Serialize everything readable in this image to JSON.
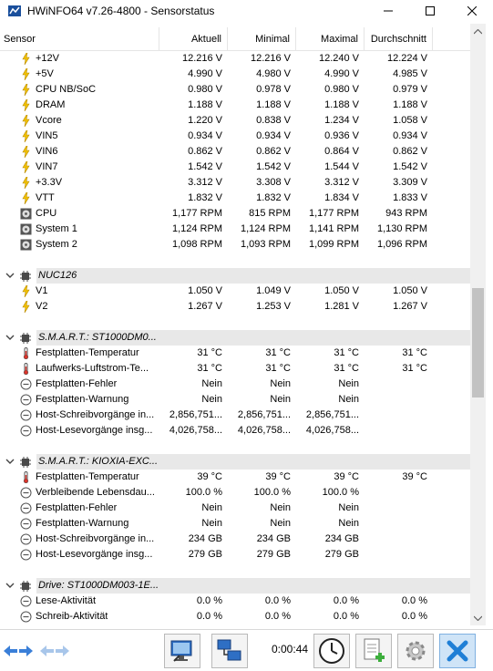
{
  "window": {
    "title": "HWiNFO64 v7.26-4800 - Sensorstatus",
    "minimize": "─",
    "maximize": "☐",
    "close": "✕"
  },
  "columns": {
    "sensor": "Sensor",
    "current": "Aktuell",
    "min": "Minimal",
    "max": "Maximal",
    "avg": "Durchschnitt"
  },
  "rows": [
    {
      "kind": "item",
      "icon": "voltage-icon",
      "label": "+12V",
      "cur": "12.216 V",
      "min": "12.216 V",
      "max": "12.240 V",
      "avg": "12.224 V"
    },
    {
      "kind": "item",
      "icon": "voltage-icon",
      "label": "+5V",
      "cur": "4.990 V",
      "min": "4.980 V",
      "max": "4.990 V",
      "avg": "4.985 V"
    },
    {
      "kind": "item",
      "icon": "voltage-icon",
      "label": "CPU NB/SoC",
      "cur": "0.980 V",
      "min": "0.978 V",
      "max": "0.980 V",
      "avg": "0.979 V"
    },
    {
      "kind": "item",
      "icon": "voltage-icon",
      "label": "DRAM",
      "cur": "1.188 V",
      "min": "1.188 V",
      "max": "1.188 V",
      "avg": "1.188 V"
    },
    {
      "kind": "item",
      "icon": "voltage-icon",
      "label": "Vcore",
      "cur": "1.220 V",
      "min": "0.838 V",
      "max": "1.234 V",
      "avg": "1.058 V"
    },
    {
      "kind": "item",
      "icon": "voltage-icon",
      "label": "VIN5",
      "cur": "0.934 V",
      "min": "0.934 V",
      "max": "0.936 V",
      "avg": "0.934 V"
    },
    {
      "kind": "item",
      "icon": "voltage-icon",
      "label": "VIN6",
      "cur": "0.862 V",
      "min": "0.862 V",
      "max": "0.864 V",
      "avg": "0.862 V"
    },
    {
      "kind": "item",
      "icon": "voltage-icon",
      "label": "VIN7",
      "cur": "1.542 V",
      "min": "1.542 V",
      "max": "1.544 V",
      "avg": "1.542 V"
    },
    {
      "kind": "item",
      "icon": "voltage-icon",
      "label": "+3.3V",
      "cur": "3.312 V",
      "min": "3.308 V",
      "max": "3.312 V",
      "avg": "3.309 V"
    },
    {
      "kind": "item",
      "icon": "voltage-icon",
      "label": "VTT",
      "cur": "1.832 V",
      "min": "1.832 V",
      "max": "1.834 V",
      "avg": "1.833 V"
    },
    {
      "kind": "item",
      "icon": "fan-icon",
      "label": "CPU",
      "cur": "1,177 RPM",
      "min": "815 RPM",
      "max": "1,177 RPM",
      "avg": "943 RPM"
    },
    {
      "kind": "item",
      "icon": "fan-icon",
      "label": "System 1",
      "cur": "1,124 RPM",
      "min": "1,124 RPM",
      "max": "1,141 RPM",
      "avg": "1,130 RPM"
    },
    {
      "kind": "item",
      "icon": "fan-icon",
      "label": "System 2",
      "cur": "1,098 RPM",
      "min": "1,093 RPM",
      "max": "1,099 RPM",
      "avg": "1,096 RPM"
    },
    {
      "kind": "blank"
    },
    {
      "kind": "group",
      "label": "NUC126"
    },
    {
      "kind": "item",
      "icon": "voltage-icon",
      "label": "V1",
      "cur": "1.050 V",
      "min": "1.049 V",
      "max": "1.050 V",
      "avg": "1.050 V"
    },
    {
      "kind": "item",
      "icon": "voltage-icon",
      "label": "V2",
      "cur": "1.267 V",
      "min": "1.253 V",
      "max": "1.281 V",
      "avg": "1.267 V"
    },
    {
      "kind": "blank"
    },
    {
      "kind": "group",
      "label": "S.M.A.R.T.: ST1000DM0..."
    },
    {
      "kind": "item",
      "icon": "thermometer-icon",
      "label": "Festplatten-Temperatur",
      "cur": "31 °C",
      "min": "31 °C",
      "max": "31 °C",
      "avg": "31 °C"
    },
    {
      "kind": "item",
      "icon": "thermometer-icon",
      "label": "Laufwerks-Luftstrom-Te...",
      "cur": "31 °C",
      "min": "31 °C",
      "max": "31 °C",
      "avg": "31 °C"
    },
    {
      "kind": "item",
      "icon": "status-icon",
      "label": "Festplatten-Fehler",
      "cur": "Nein",
      "min": "Nein",
      "max": "Nein",
      "avg": ""
    },
    {
      "kind": "item",
      "icon": "status-icon",
      "label": "Festplatten-Warnung",
      "cur": "Nein",
      "min": "Nein",
      "max": "Nein",
      "avg": ""
    },
    {
      "kind": "item",
      "icon": "status-icon",
      "label": "Host-Schreibvorgänge in...",
      "cur": "2,856,751...",
      "min": "2,856,751...",
      "max": "2,856,751...",
      "avg": ""
    },
    {
      "kind": "item",
      "icon": "status-icon",
      "label": "Host-Lesevorgänge insg...",
      "cur": "4,026,758...",
      "min": "4,026,758...",
      "max": "4,026,758...",
      "avg": ""
    },
    {
      "kind": "blank"
    },
    {
      "kind": "group",
      "label": "S.M.A.R.T.: KIOXIA-EXC..."
    },
    {
      "kind": "item",
      "icon": "thermometer-icon",
      "label": "Festplatten-Temperatur",
      "cur": "39 °C",
      "min": "39 °C",
      "max": "39 °C",
      "avg": "39 °C"
    },
    {
      "kind": "item",
      "icon": "status-icon",
      "label": "Verbleibende Lebensdau...",
      "cur": "100.0 %",
      "min": "100.0 %",
      "max": "100.0 %",
      "avg": ""
    },
    {
      "kind": "item",
      "icon": "status-icon",
      "label": "Festplatten-Fehler",
      "cur": "Nein",
      "min": "Nein",
      "max": "Nein",
      "avg": ""
    },
    {
      "kind": "item",
      "icon": "status-icon",
      "label": "Festplatten-Warnung",
      "cur": "Nein",
      "min": "Nein",
      "max": "Nein",
      "avg": ""
    },
    {
      "kind": "item",
      "icon": "status-icon",
      "label": "Host-Schreibvorgänge in...",
      "cur": "234 GB",
      "min": "234 GB",
      "max": "234 GB",
      "avg": ""
    },
    {
      "kind": "item",
      "icon": "status-icon",
      "label": "Host-Lesevorgänge insg...",
      "cur": "279 GB",
      "min": "279 GB",
      "max": "279 GB",
      "avg": ""
    },
    {
      "kind": "blank"
    },
    {
      "kind": "group",
      "label": "Drive: ST1000DM003-1E..."
    },
    {
      "kind": "item",
      "icon": "status-icon",
      "label": "Lese-Aktivität",
      "cur": "0.0 %",
      "min": "0.0 %",
      "max": "0.0 %",
      "avg": "0.0 %"
    },
    {
      "kind": "item",
      "icon": "status-icon",
      "label": "Schreib-Aktivität",
      "cur": "0.0 %",
      "min": "0.0 %",
      "max": "0.0 %",
      "avg": "0.0 %"
    }
  ],
  "toolbar": {
    "timer": "0:00:44"
  },
  "colors": {
    "accent": "#1f7fd6",
    "group_bg": "#e8e8e8",
    "close_bg": "#cfe4f7"
  }
}
